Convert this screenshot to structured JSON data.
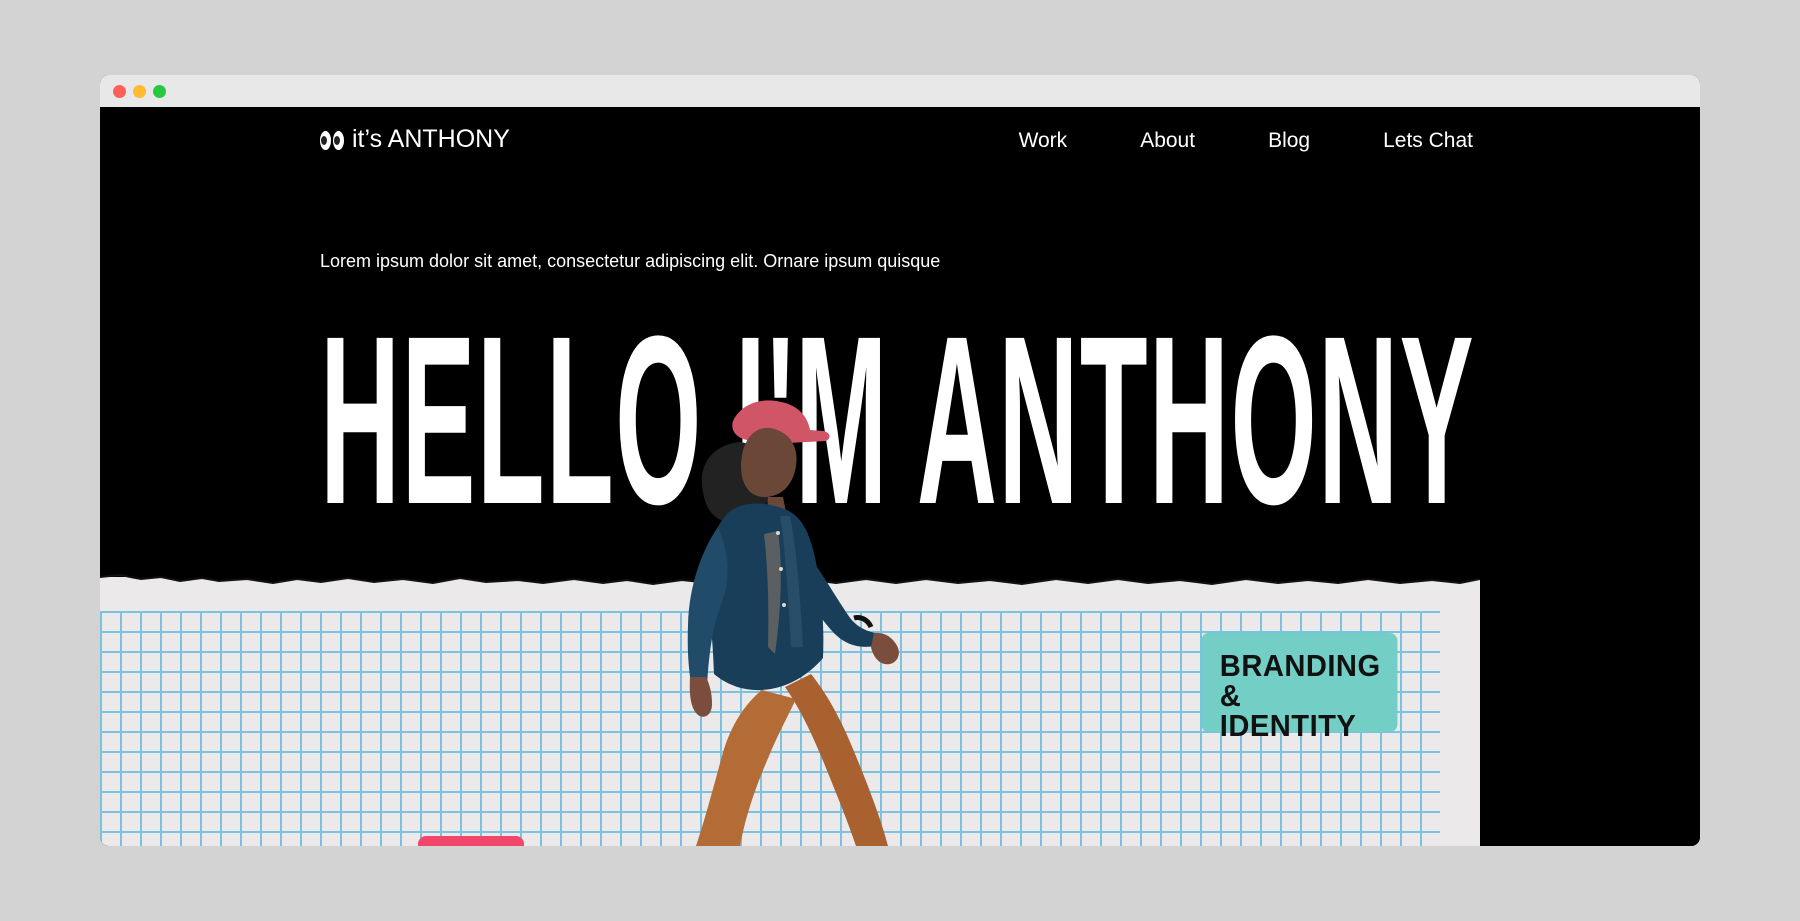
{
  "window": {
    "controls": {
      "close": "close-dot",
      "minimize": "minimize-dot",
      "maximize": "maximize-dot"
    }
  },
  "header": {
    "brand_icon": "eyes-icon",
    "brand_text": "it’s ANTHONY",
    "nav": {
      "work": "Work",
      "about": "About",
      "blog": "Blog",
      "chat": "Lets Chat"
    }
  },
  "hero": {
    "intro": "Lorem ipsum dolor sit amet, consectetur adipiscing elit. Ornare ipsum quisque",
    "headline": "HELLO I'M ANTHONY"
  },
  "badge": {
    "line1": "BRANDING &",
    "line2": "IDENTITY"
  },
  "colors": {
    "page_background": "#000000",
    "panel_background": "#ece9ea",
    "grid_line": "#76bfe0",
    "badge_background": "#73cfc5",
    "accent_pink": "#f2466a"
  }
}
